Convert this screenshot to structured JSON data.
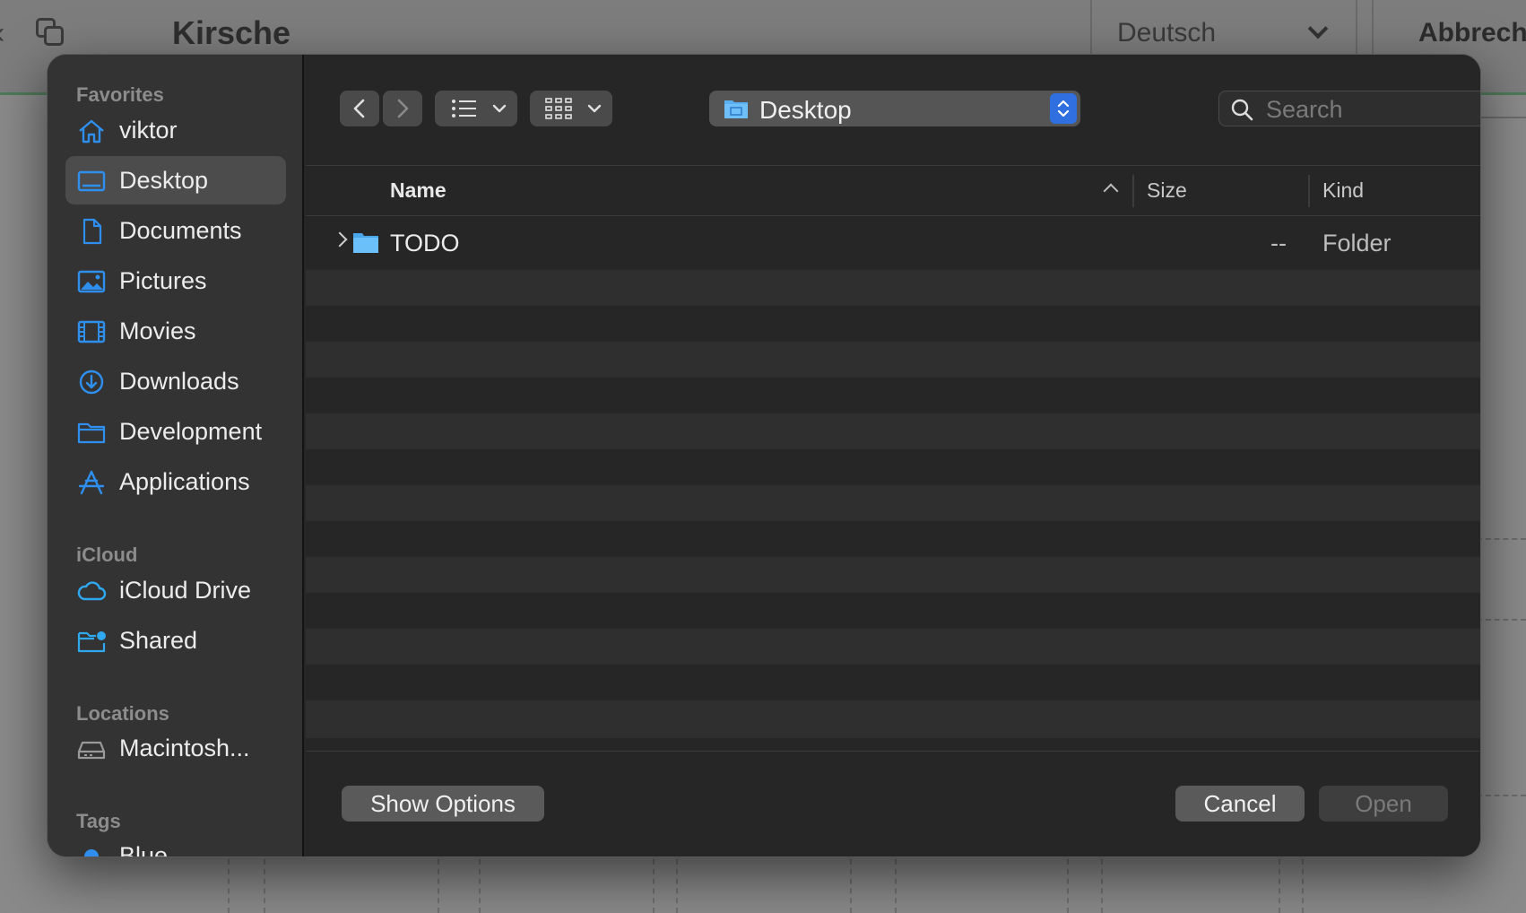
{
  "background": {
    "title": "Kirsche",
    "language": "Deutsch",
    "cancel": "Abbreche"
  },
  "sidebar": {
    "sections": [
      {
        "label": "Favorites",
        "items": [
          {
            "label": "viktor",
            "icon": "home-icon"
          },
          {
            "label": "Desktop",
            "icon": "desktop-icon",
            "selected": true
          },
          {
            "label": "Documents",
            "icon": "document-icon"
          },
          {
            "label": "Pictures",
            "icon": "photo-icon"
          },
          {
            "label": "Movies",
            "icon": "film-icon"
          },
          {
            "label": "Downloads",
            "icon": "download-icon"
          },
          {
            "label": "Development",
            "icon": "folder-icon"
          },
          {
            "label": "Applications",
            "icon": "applications-icon"
          }
        ]
      },
      {
        "label": "iCloud",
        "items": [
          {
            "label": "iCloud Drive",
            "icon": "cloud-icon"
          },
          {
            "label": "Shared",
            "icon": "shared-folder-icon"
          }
        ]
      },
      {
        "label": "Locations",
        "items": [
          {
            "label": "Macintosh...",
            "icon": "disk-icon"
          }
        ]
      },
      {
        "label": "Tags",
        "items": [
          {
            "label": "Blue",
            "icon": "tag-dot-icon"
          }
        ]
      }
    ]
  },
  "toolbar": {
    "location": "Desktop",
    "search_placeholder": "Search"
  },
  "columns": {
    "name": "Name",
    "size": "Size",
    "kind": "Kind"
  },
  "files": [
    {
      "name": "TODO",
      "size": "--",
      "kind": "Folder"
    }
  ],
  "footer": {
    "options": "Show Options",
    "cancel": "Cancel",
    "open": "Open"
  },
  "colors": {
    "accent": "#2f8fef",
    "selection": "#4c4c4c",
    "dialog": "#262626"
  }
}
